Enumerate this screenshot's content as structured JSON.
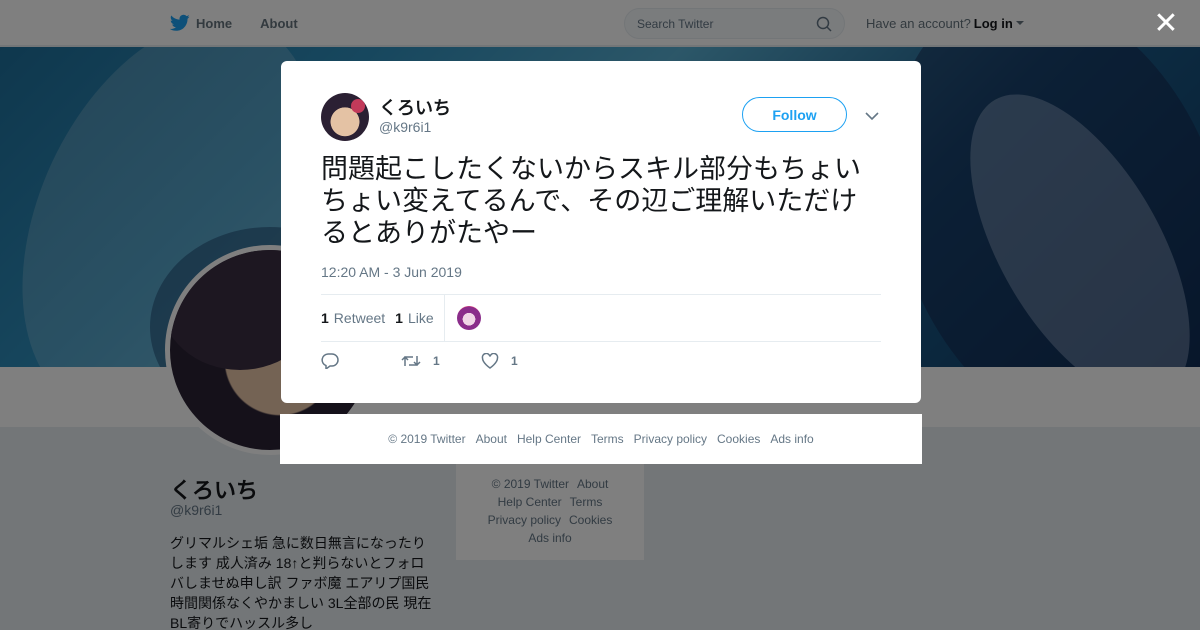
{
  "nav": {
    "home_label": "Home",
    "about_label": "About",
    "search_placeholder": "Search Twitter",
    "have_account": "Have an account?",
    "login_label": "Log in"
  },
  "profile": {
    "name": "くろいち",
    "handle": "@k9r6i1",
    "bio": "グリマルシェ垢 急に数日無言になったりします 成人済み 18↑と判らないとフォロバしませぬ申し訳 ファボ魔 エアリプ国民 時間関係なくやかましい 3L全部の民 現在BL寄りでハッスル多し"
  },
  "side_footer": {
    "copyright": "© 2019 Twitter",
    "about": "About",
    "help": "Help Center",
    "terms": "Terms",
    "privacy": "Privacy policy",
    "cookies": "Cookies",
    "ads": "Ads info"
  },
  "tweet": {
    "author_name": "くろいち",
    "author_handle": "@k9r6i1",
    "follow_label": "Follow",
    "text": "問題起こしたくないからスキル部分もちょいちょい変えてるんで、その辺ご理解いただけるとありがたやー",
    "timestamp": "12:20 AM - 3 Jun 2019",
    "retweets_count": "1",
    "retweets_label": "Retweet",
    "likes_count": "1",
    "likes_label": "Like",
    "action_retweet_count": "1",
    "action_like_count": "1"
  },
  "modal_footer": {
    "copyright": "© 2019 Twitter",
    "about": "About",
    "help": "Help Center",
    "terms": "Terms",
    "privacy": "Privacy policy",
    "cookies": "Cookies",
    "ads": "Ads info"
  },
  "colors": {
    "twitter_blue": "#1da1f2",
    "text_gray": "#657786"
  }
}
